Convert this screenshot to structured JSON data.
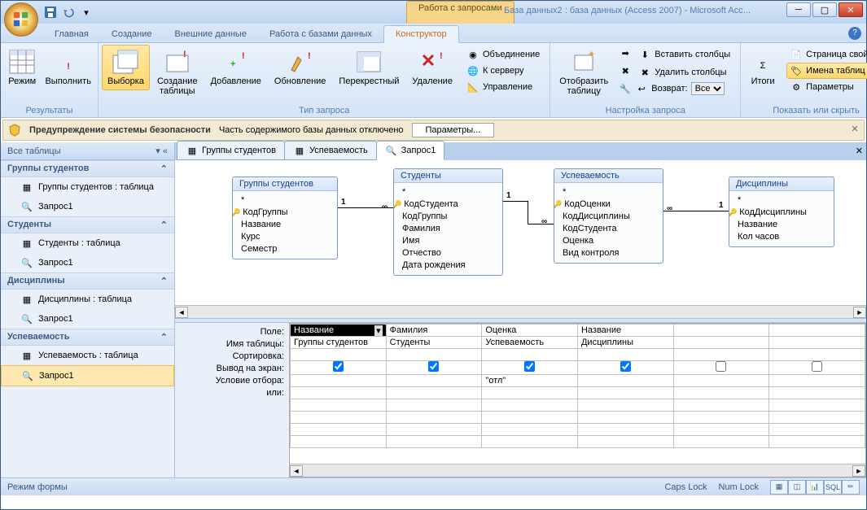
{
  "window": {
    "context_tab": "Работа с запросами",
    "title": "База данных2 : база данных (Access 2007) - Microsoft Acc..."
  },
  "tabs": {
    "home": "Главная",
    "create": "Создание",
    "external": "Внешние данные",
    "dbtools": "Работа с базами данных",
    "design": "Конструктор"
  },
  "ribbon": {
    "results": {
      "view": "Режим",
      "run": "Выполнить",
      "label": "Результаты"
    },
    "qtype": {
      "select": "Выборка",
      "maketable": "Создание\nтаблицы",
      "append": "Добавление",
      "update": "Обновление",
      "crosstab": "Перекрестный",
      "delete": "Удаление",
      "union": "Объединение",
      "passthrough": "К серверу",
      "datadef": "Управление",
      "label": "Тип запроса"
    },
    "setup": {
      "showtable": "Отобразить\nтаблицу",
      "insertcols": "Вставить столбцы",
      "deletecols": "Удалить столбцы",
      "return": "Возврат:",
      "return_value": "Все",
      "label": "Настройка запроса"
    },
    "showhide": {
      "totals": "Итоги",
      "propsheet": "Страница свойств",
      "tablenames": "Имена таблиц",
      "parameters": "Параметры",
      "label": "Показать или скрыть"
    }
  },
  "security": {
    "title": "Предупреждение системы безопасности",
    "msg": "Часть содержимого базы данных отключено",
    "btn": "Параметры..."
  },
  "nav": {
    "header": "Все таблицы",
    "g1": {
      "title": "Группы студентов",
      "items": [
        "Группы студентов : таблица",
        "Запрос1"
      ]
    },
    "g2": {
      "title": "Студенты",
      "items": [
        "Студенты : таблица",
        "Запрос1"
      ]
    },
    "g3": {
      "title": "Дисциплины",
      "items": [
        "Дисциплины : таблица",
        "Запрос1"
      ]
    },
    "g4": {
      "title": "Успеваемость",
      "items": [
        "Успеваемость : таблица",
        "Запрос1"
      ]
    }
  },
  "doctabs": [
    "Группы студентов",
    "Успеваемость",
    "Запрос1"
  ],
  "tables": {
    "t1": {
      "title": "Группы студентов",
      "fields": [
        "*",
        "КодГруппы",
        "Название",
        "Курс",
        "Семестр"
      ],
      "key": 1
    },
    "t2": {
      "title": "Студенты",
      "fields": [
        "*",
        "КодСтудента",
        "КодГруппы",
        "Фамилия",
        "Имя",
        "Отчество",
        "Дата рождения"
      ],
      "key": 1
    },
    "t3": {
      "title": "Успеваемость",
      "fields": [
        "*",
        "КодОценки",
        "КодДисциплины",
        "КодСтудента",
        "Оценка",
        "Вид контроля"
      ],
      "key": 1
    },
    "t4": {
      "title": "Дисциплины",
      "fields": [
        "*",
        "КодДисциплины",
        "Название",
        "Кол часов"
      ],
      "key": 1
    }
  },
  "rel": {
    "one": "1",
    "many": "∞"
  },
  "grid": {
    "labels": {
      "field": "Поле:",
      "table": "Имя таблицы:",
      "sort": "Сортировка:",
      "show": "Вывод на экран:",
      "criteria": "Условие отбора:",
      "or": "или:"
    },
    "cols": [
      {
        "field": "Название",
        "table": "Группы студентов",
        "show": true,
        "criteria": ""
      },
      {
        "field": "Фамилия",
        "table": "Студенты",
        "show": true,
        "criteria": ""
      },
      {
        "field": "Оценка",
        "table": "Успеваемость",
        "show": true,
        "criteria": "\"отл\""
      },
      {
        "field": "Название",
        "table": "Дисциплины",
        "show": true,
        "criteria": ""
      },
      {
        "field": "",
        "table": "",
        "show": false,
        "criteria": ""
      },
      {
        "field": "",
        "table": "",
        "show": false,
        "criteria": ""
      }
    ]
  },
  "status": {
    "mode": "Режим формы",
    "caps": "Caps Lock",
    "num": "Num Lock"
  }
}
